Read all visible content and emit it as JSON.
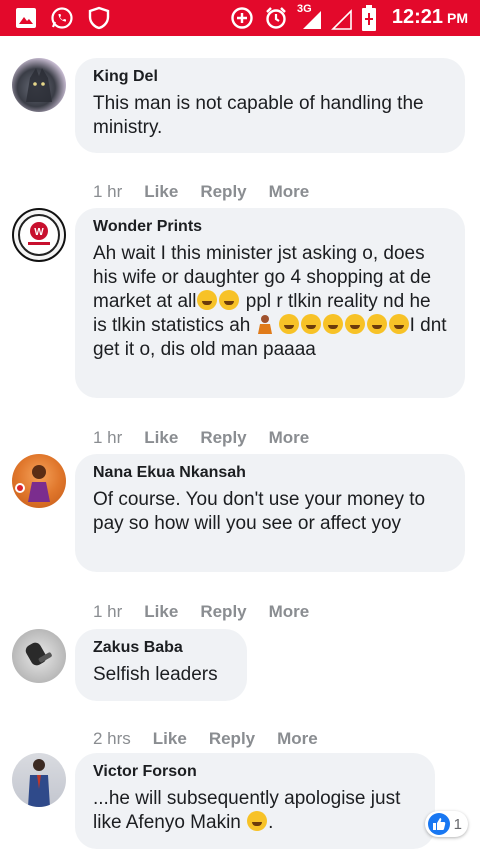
{
  "status_bar": {
    "time": "12:21",
    "ampm": "PM",
    "network": "3G",
    "icons": [
      "gallery-icon",
      "whatsapp-icon",
      "shield-icon",
      "add-circle-icon",
      "alarm-icon",
      "signal-icon",
      "battery-charging-icon"
    ]
  },
  "comments": [
    {
      "author": "King Del",
      "text": "This man is not capable of handling the ministry.",
      "time": "1 hr",
      "like": "Like",
      "reply": "Reply",
      "more": "More"
    },
    {
      "author": "Wonder Prints",
      "text_part1": "Ah wait I this minister jst asking o, does his wife or daughter go 4 shopping at de market at all",
      "text_part2": " ppl r tlkin reality nd he is tlkin statistics ah ",
      "text_part3": "I dnt get it o, dis old man paaaa",
      "time": "1 hr",
      "like": "Like",
      "reply": "Reply",
      "more": "More"
    },
    {
      "author": "Nana Ekua Nkansah",
      "text": "Of course. You don't use your money to pay so how will you see or affect yoy",
      "time": "1 hr",
      "like": "Like",
      "reply": "Reply",
      "more": "More"
    },
    {
      "author": "Zakus Baba",
      "text": "Selfish leaders",
      "time": "2 hrs",
      "like": "Like",
      "reply": "Reply",
      "more": "More"
    },
    {
      "author": "Victor Forson",
      "text": "...he will subsequently apologise just like Afenyo Makin ",
      "reaction_count": "1"
    }
  ],
  "colors": {
    "status_bar": "#e3092b",
    "bubble": "#f0f2f5",
    "like_blue": "#1877f2",
    "action_gray": "#8a8d91"
  }
}
